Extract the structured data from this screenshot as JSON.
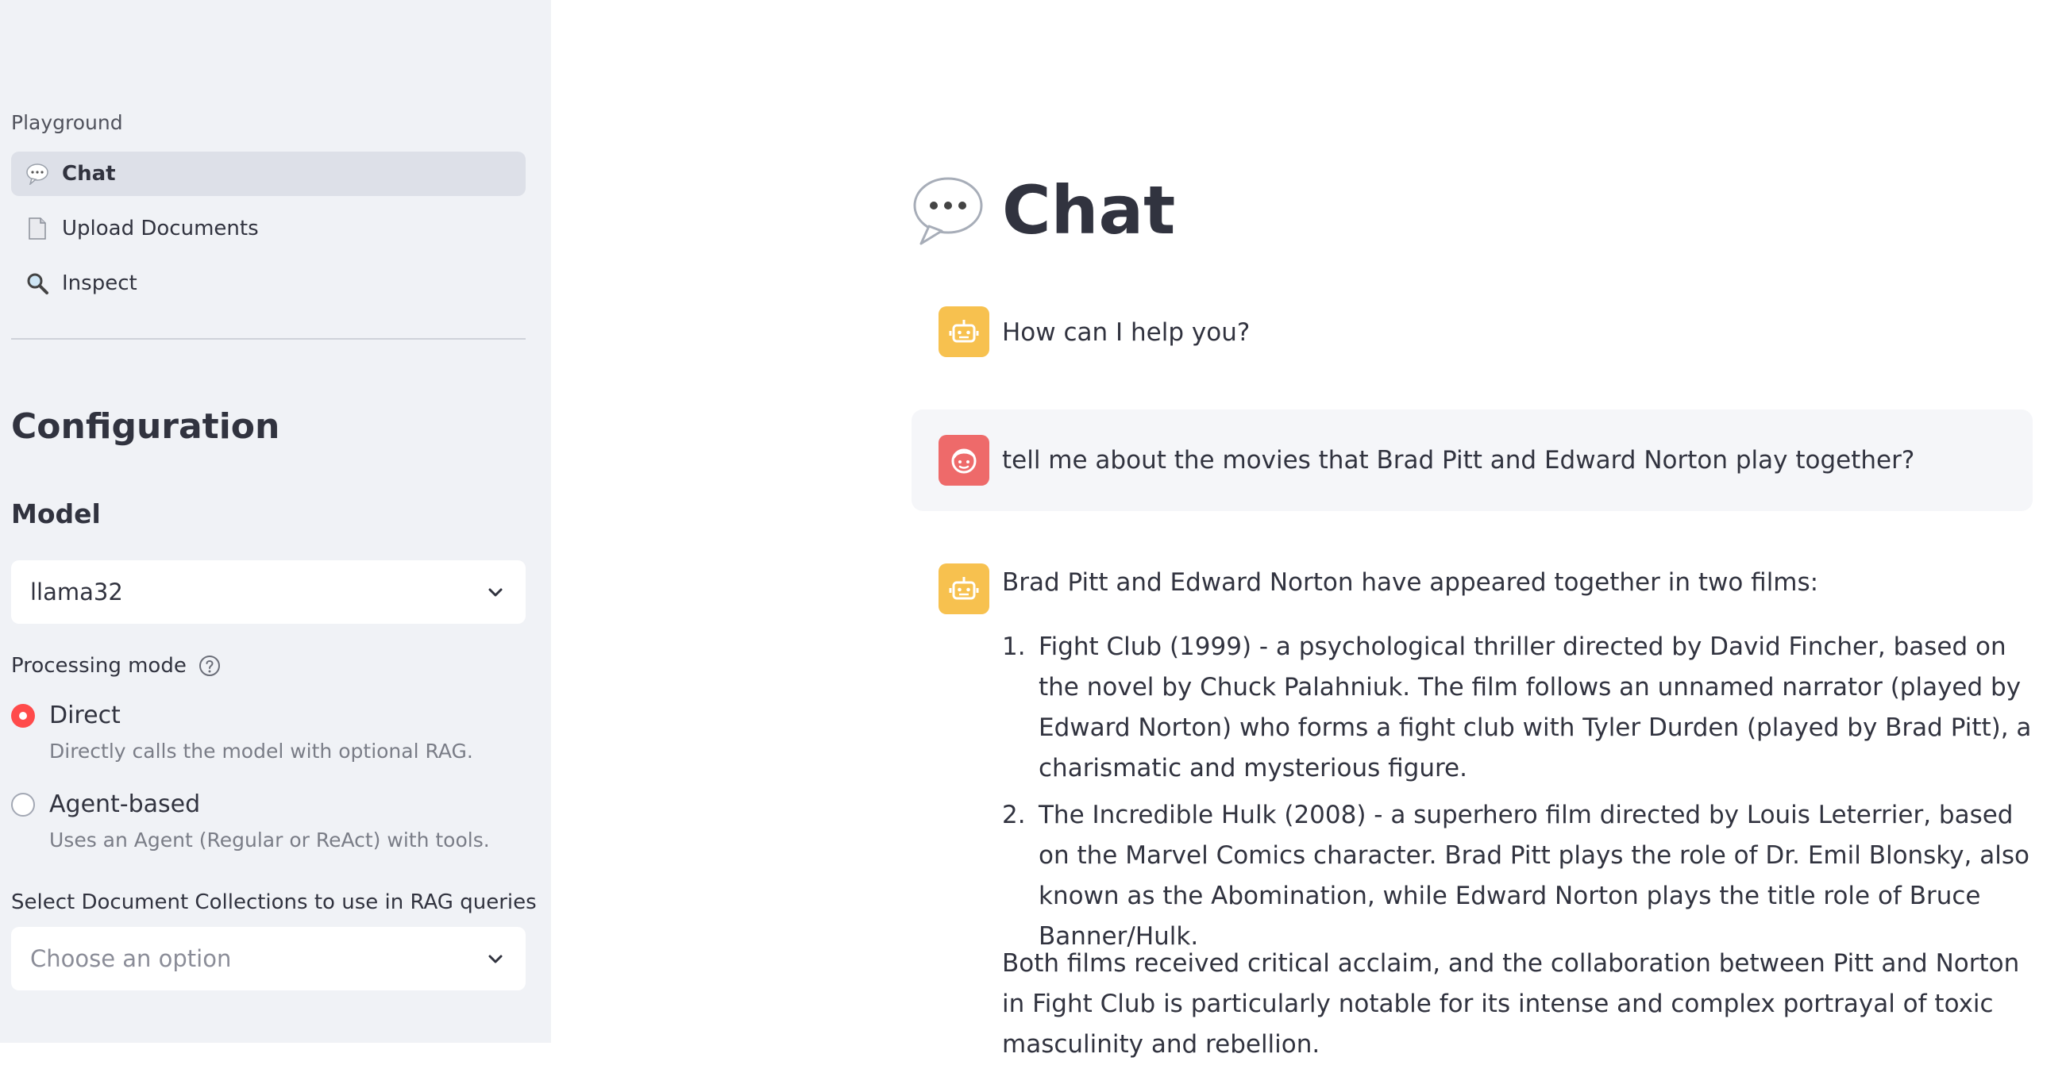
{
  "sidebar": {
    "nav_header": "Playground",
    "nav_items": [
      {
        "label": "Chat",
        "icon": "speech-balloon-icon",
        "active": true
      },
      {
        "label": "Upload Documents",
        "icon": "document-icon",
        "active": false
      },
      {
        "label": "Inspect",
        "icon": "magnifier-icon",
        "active": false
      }
    ],
    "config_title": "Configuration",
    "model_label": "Model",
    "model_value": "llama32",
    "processing_mode_label": "Processing mode",
    "modes": [
      {
        "label": "Direct",
        "description": "Directly calls the model with optional RAG.",
        "selected": true
      },
      {
        "label": "Agent-based",
        "description": "Uses an Agent (Regular or ReAct) with tools.",
        "selected": false
      }
    ],
    "collections_label": "Select Document Collections to use in RAG queries",
    "collections_placeholder": "Choose an option",
    "accent_color": "#ff4b4b"
  },
  "main": {
    "title": "Chat",
    "title_icon": "speech-balloon-icon",
    "messages": [
      {
        "role": "assistant",
        "text": "How can I help you?"
      },
      {
        "role": "user",
        "text": "tell me about the movies that Brad Pitt and Edward Norton play together?"
      },
      {
        "role": "assistant",
        "intro": "Brad Pitt and Edward Norton have appeared together in two films:",
        "items": [
          "Fight Club (1999) - a psychological thriller directed by David Fincher, based on the novel by Chuck Palahniuk. The film follows an unnamed narrator (played by Edward Norton) who forms a fight club with Tyler Durden (played by Brad Pitt), a charismatic and mysterious figure.",
          "The Incredible Hulk (2008) - a superhero film directed by Louis Leterrier, based on the Marvel Comics character. Brad Pitt plays the role of Dr. Emil Blonsky, also known as the Abomination, while Edward Norton plays the title role of Bruce Banner/Hulk."
        ],
        "outro": "Both films received critical acclaim, and the collaboration between Pitt and Norton in Fight Club is particularly notable for its intense and complex portrayal of toxic masculinity and rebellion."
      }
    ],
    "assistant_avatar_color": "#f7c14f",
    "user_avatar_color": "#ee6a6a"
  }
}
